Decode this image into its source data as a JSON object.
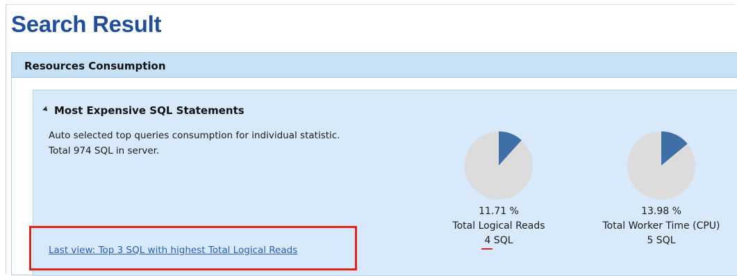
{
  "page": {
    "title": "Search Result"
  },
  "panel": {
    "title": "Resources Consumption"
  },
  "section": {
    "title": "Most Expensive SQL Statements",
    "description_line1": "Auto selected top queries consumption for individual statistic.",
    "description_line2": "Total 974 SQL in server."
  },
  "stats": [
    {
      "percent_label": "11.71 %",
      "percent_value": 11.71,
      "metric": "Total Logical Reads",
      "count_label": "4  SQL"
    },
    {
      "percent_label": "13.98 %",
      "percent_value": 13.98,
      "metric": "Total Worker Time (CPU)",
      "count_label": "5  SQL"
    }
  ],
  "last_view_link": "Last view: Top 3 SQL with highest Total Logical Reads",
  "colors": {
    "pie_slice": "#3f6fa7",
    "pie_base": "#dcdcdc",
    "highlight": "#e2231a",
    "title": "#1f4f9a"
  }
}
